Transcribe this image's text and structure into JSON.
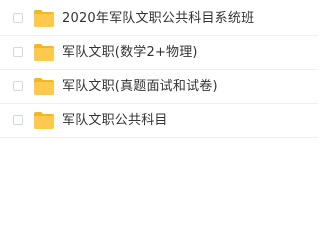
{
  "colors": {
    "folder_fill": "#FFC94D",
    "folder_tab": "#F5B625",
    "text": "#333333",
    "divider": "#eef0f3"
  },
  "files": [
    {
      "name": "2020年军队文职公共科目系统班",
      "icon": "folder-icon"
    },
    {
      "name": "军队文职(数学2+物理)",
      "icon": "folder-icon"
    },
    {
      "name": "军队文职(真题面试和试卷)",
      "icon": "folder-icon"
    },
    {
      "name": "军队文职公共科目",
      "icon": "folder-icon"
    }
  ]
}
